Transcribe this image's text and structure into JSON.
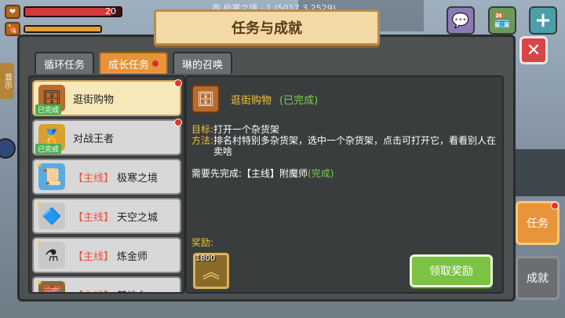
{
  "hud": {
    "hp_value": "20",
    "hp_fraction": 0.9,
    "hp_icon": "heart-icon",
    "food_icon": "food-icon"
  },
  "coords_text": "西  极寒之境 · 1  (5017,3,2529)",
  "top_buttons": [
    {
      "name": "chat-icon",
      "glyph": "💬"
    },
    {
      "name": "shop-icon",
      "glyph": "🏪"
    },
    {
      "name": "plus-icon",
      "glyph": "+"
    }
  ],
  "title": "任务与成就",
  "close_glyph": "✕",
  "tabs": [
    {
      "label": "循环任务",
      "active": false,
      "dot": false
    },
    {
      "label": "成长任务",
      "active": true,
      "dot": true
    },
    {
      "label": "琳的召唤",
      "active": false,
      "dot": false
    }
  ],
  "list": [
    {
      "tag": "",
      "label": "逛街购物",
      "badge": "已完成",
      "selected": true,
      "red_dot": true,
      "star": false,
      "icon": "shelf-icon",
      "glyph": "🗄",
      "icon_color": "#b86b2c"
    },
    {
      "tag": "",
      "label": "对战王者",
      "badge": "已完成",
      "selected": false,
      "red_dot": true,
      "star": false,
      "icon": "medal-icon",
      "glyph": "🏅",
      "icon_color": "#d9a030"
    },
    {
      "tag": "【主线】",
      "label": "极寒之境",
      "badge": "",
      "selected": false,
      "red_dot": false,
      "star": true,
      "icon": "scroll-icon",
      "glyph": "📜",
      "icon_color": "#5aaae0"
    },
    {
      "tag": "【主线】",
      "label": "天空之城",
      "badge": "",
      "selected": false,
      "red_dot": false,
      "star": true,
      "icon": "crystal-icon",
      "glyph": "🔷",
      "icon_color": "#c8c8c8"
    },
    {
      "tag": "【主线】",
      "label": "炼金师",
      "badge": "",
      "selected": false,
      "red_dot": false,
      "star": true,
      "icon": "alchemy-icon",
      "glyph": "⚗",
      "icon_color": "#c8c8c8"
    },
    {
      "tag": "【主线】",
      "label": "基地台",
      "badge": "",
      "selected": false,
      "red_dot": false,
      "star": true,
      "icon": "base-icon",
      "glyph": "🧱",
      "icon_color": "#8a6a3a"
    }
  ],
  "detail": {
    "title": "逛街购物",
    "status": "(已完成)",
    "goal_key": "目标:",
    "goal_text": "打开一个杂货架",
    "method_key": "方法:",
    "method_text": "排名村特别多杂货架，选中一个杂货架，点击可打开它，看看别人在卖啥",
    "prereq_prefix": "需要先完成:",
    "prereq_task": "【主线】附魔师",
    "prereq_status": "(完成)",
    "reward_label": "奖励:",
    "reward_count": "1800",
    "reward_icon": "exp-chevron-icon",
    "claim_label": "领取奖励"
  },
  "side": {
    "left_tab": "显示",
    "task_label": "任务",
    "achievement_label": "成就"
  },
  "colors": {
    "accent_orange": "#e8943a",
    "done_green": "#7ad04a",
    "highlight_yellow": "#f1c232",
    "claim_green": "#7cc243",
    "close_red": "#d94444"
  }
}
